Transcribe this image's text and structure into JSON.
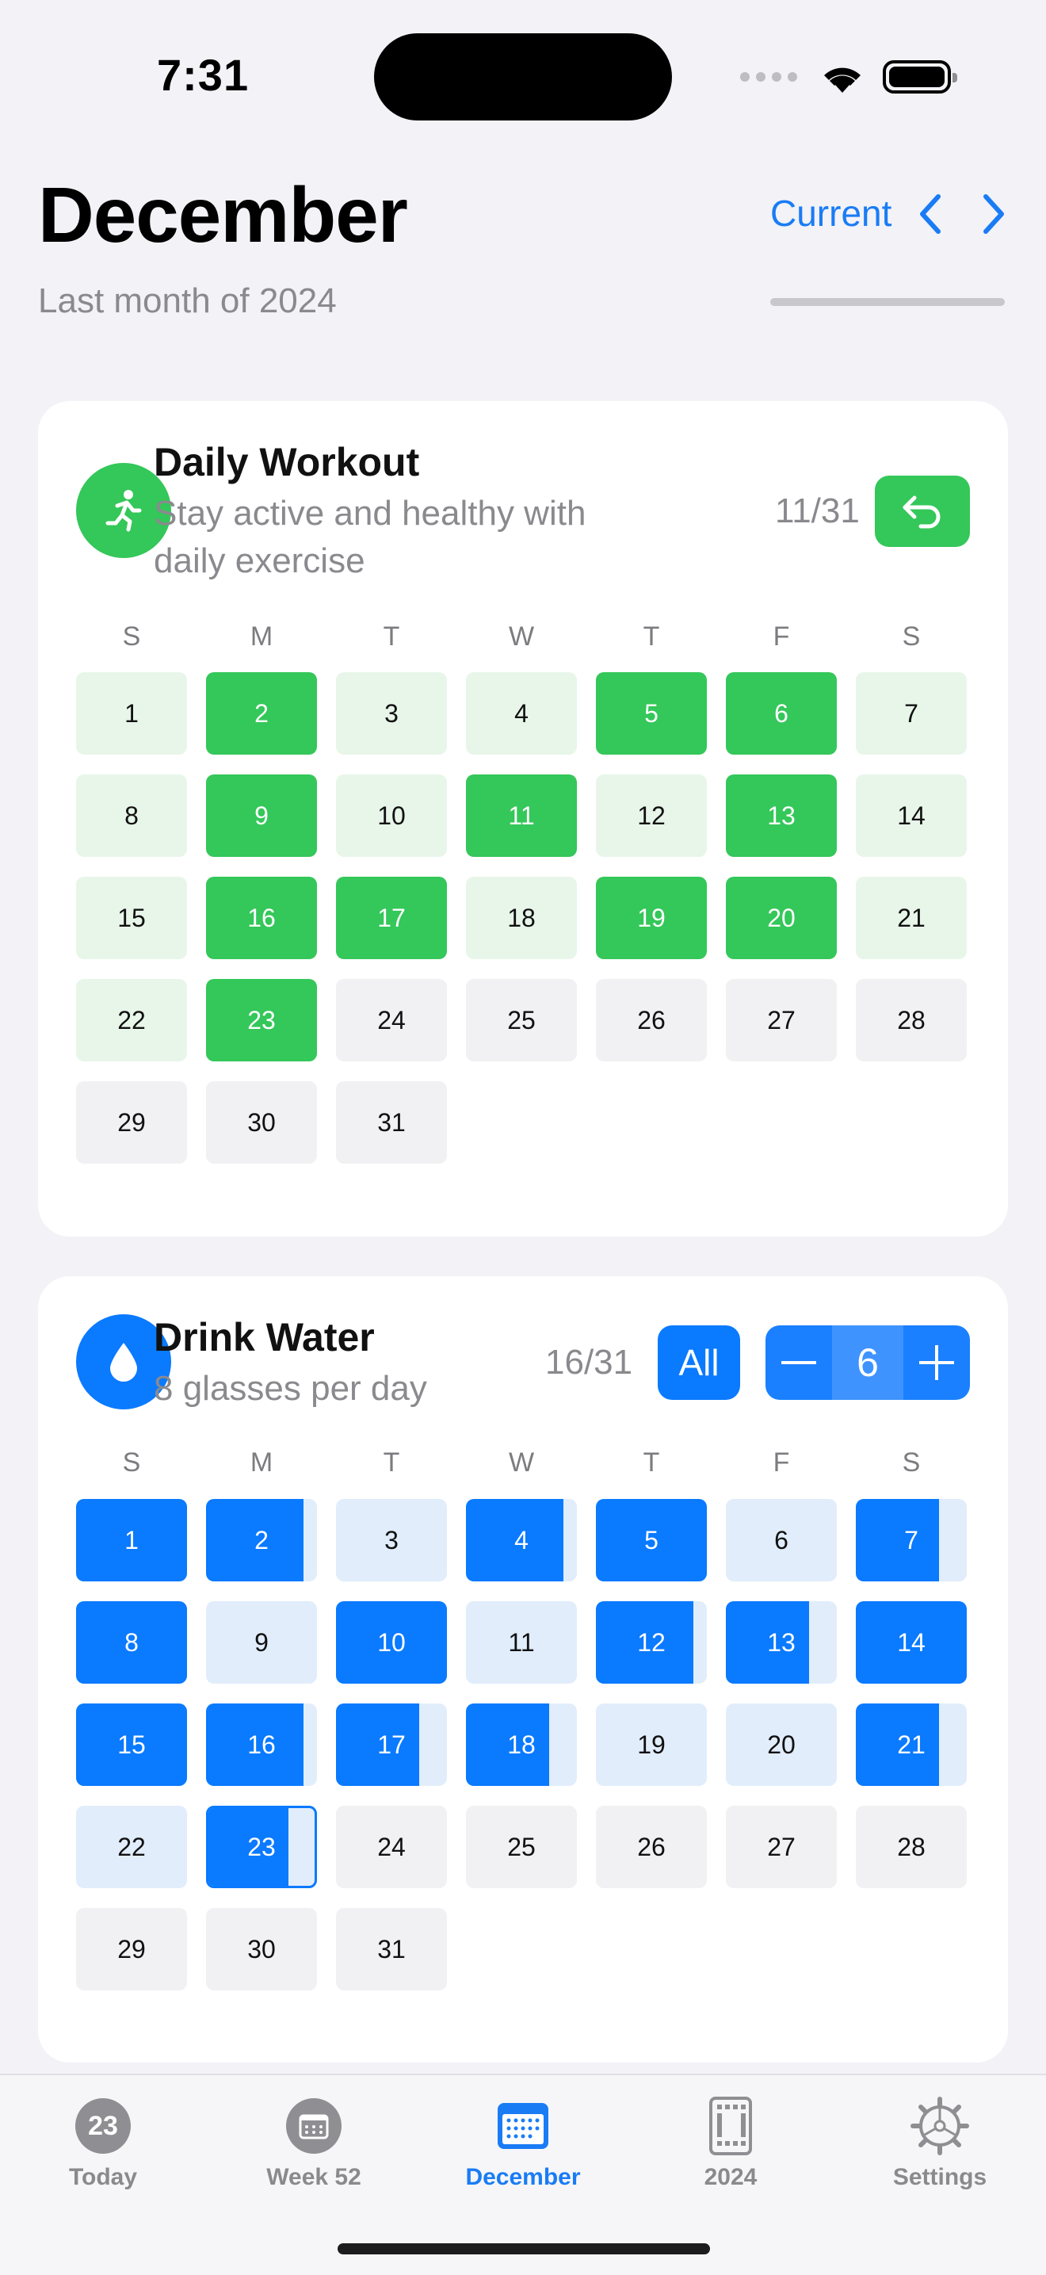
{
  "status": {
    "time": "7:31"
  },
  "header": {
    "title": "December",
    "subtitle": "Last month of 2024",
    "current_label": "Current"
  },
  "weekdays": [
    "S",
    "M",
    "T",
    "W",
    "T",
    "F",
    "S"
  ],
  "habits": [
    {
      "title": "Daily Workout",
      "description_line1": "Stay active and healthy with",
      "description_line2": "daily exercise",
      "progress": "11/31",
      "icon": "running-figure-icon",
      "color": "#34c759",
      "days": [
        {
          "day": "1",
          "status": "missed"
        },
        {
          "day": "2",
          "status": "done"
        },
        {
          "day": "3",
          "status": "missed"
        },
        {
          "day": "4",
          "status": "missed"
        },
        {
          "day": "5",
          "status": "done"
        },
        {
          "day": "6",
          "status": "done"
        },
        {
          "day": "7",
          "status": "missed"
        },
        {
          "day": "8",
          "status": "missed"
        },
        {
          "day": "9",
          "status": "done"
        },
        {
          "day": "10",
          "status": "missed"
        },
        {
          "day": "11",
          "status": "done"
        },
        {
          "day": "12",
          "status": "missed"
        },
        {
          "day": "13",
          "status": "done"
        },
        {
          "day": "14",
          "status": "missed"
        },
        {
          "day": "15",
          "status": "missed"
        },
        {
          "day": "16",
          "status": "done"
        },
        {
          "day": "17",
          "status": "done"
        },
        {
          "day": "18",
          "status": "missed"
        },
        {
          "day": "19",
          "status": "done"
        },
        {
          "day": "20",
          "status": "done"
        },
        {
          "day": "21",
          "status": "missed"
        },
        {
          "day": "22",
          "status": "missed"
        },
        {
          "day": "23",
          "status": "done"
        },
        {
          "day": "24",
          "status": "future"
        },
        {
          "day": "25",
          "status": "future"
        },
        {
          "day": "26",
          "status": "future"
        },
        {
          "day": "27",
          "status": "future"
        },
        {
          "day": "28",
          "status": "future"
        },
        {
          "day": "29",
          "status": "future"
        },
        {
          "day": "30",
          "status": "future"
        },
        {
          "day": "31",
          "status": "future"
        }
      ]
    },
    {
      "title": "Drink Water",
      "description_line1": "8 glasses per day",
      "progress": "16/31",
      "all_label": "All",
      "stepper_value": "6",
      "icon": "water-drop-icon",
      "color": "#0a7aff",
      "days": [
        {
          "day": "1",
          "fill": 1.0
        },
        {
          "day": "2",
          "fill": 0.875
        },
        {
          "day": "3",
          "fill": 0
        },
        {
          "day": "4",
          "fill": 0.875
        },
        {
          "day": "5",
          "fill": 1.0
        },
        {
          "day": "6",
          "fill": 0
        },
        {
          "day": "7",
          "fill": 0.75
        },
        {
          "day": "8",
          "fill": 1.0
        },
        {
          "day": "9",
          "fill": 0
        },
        {
          "day": "10",
          "fill": 1.0
        },
        {
          "day": "11",
          "fill": 0
        },
        {
          "day": "12",
          "fill": 0.875
        },
        {
          "day": "13",
          "fill": 0.75
        },
        {
          "day": "14",
          "fill": 1.0
        },
        {
          "day": "15",
          "fill": 1.0
        },
        {
          "day": "16",
          "fill": 0.875
        },
        {
          "day": "17",
          "fill": 0.75
        },
        {
          "day": "18",
          "fill": 0.75
        },
        {
          "day": "19",
          "fill": 0
        },
        {
          "day": "20",
          "fill": 0
        },
        {
          "day": "21",
          "fill": 0.75
        },
        {
          "day": "22",
          "fill": 0
        },
        {
          "day": "23",
          "fill": 0.75,
          "today": true
        },
        {
          "day": "24",
          "fill": null
        },
        {
          "day": "25",
          "fill": null
        },
        {
          "day": "26",
          "fill": null
        },
        {
          "day": "27",
          "fill": null
        },
        {
          "day": "28",
          "fill": null
        },
        {
          "day": "29",
          "fill": null
        },
        {
          "day": "30",
          "fill": null
        },
        {
          "day": "31",
          "fill": null
        }
      ]
    }
  ],
  "tabs": [
    {
      "label": "Today",
      "icon": "calendar-day-badge-icon",
      "badge": "23",
      "active": false
    },
    {
      "label": "Week 52",
      "icon": "week-calendar-icon",
      "active": false
    },
    {
      "label": "December",
      "icon": "month-calendar-icon",
      "active": true
    },
    {
      "label": "2024",
      "icon": "year-calendar-icon",
      "active": false
    },
    {
      "label": "Settings",
      "icon": "gear-icon",
      "active": false
    }
  ],
  "colors": {
    "accent": "#1a7cf5",
    "green": "#34c759",
    "blue": "#0a7aff"
  }
}
